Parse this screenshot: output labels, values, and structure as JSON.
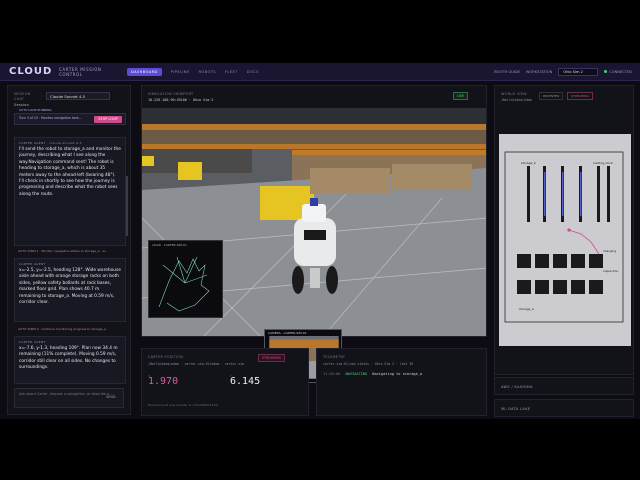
{
  "nav": {
    "logo": "CLOUD",
    "app_title": "CARTER MISSION CONTROL",
    "tabs": [
      "DASHBOARD",
      "PIPELINE",
      "ROBOTS",
      "FLEET",
      "DOCS"
    ],
    "booth_guide": "BOOTH GUIDE",
    "workstation_label": "WORKSTATION",
    "workstation_value": "Ohio Sim 2",
    "status": "CONNECTED"
  },
  "left": {
    "mission_label": "MISSION",
    "chat_label": "CHAT",
    "session_label": "Session",
    "model": "Claude Sonnet 4.5",
    "loop_label": "AUTO LOOP RUNNING",
    "loop_text": "Turn 3 of 10 · Monitor navigation task...",
    "stop_loop": "STOP LOOP",
    "msg1_header": "CARTER AGENT",
    "msg1_model": "claude-sonnet-4-5",
    "msg1_body": "I'll send the robot to storage_a and monitor the journey, describing what I see along the way.Navigation command sent! The robot is heading to storage_a, which is about 35 meters away to the ahead-left (bearing 48°). I'll check in shortly to see how the journey is progressing and describe what the robot sees along the route.",
    "tool1": "AUTO TURN 1 · Monitor navigation status to storage_a - w...",
    "msg2_header": "CARTER AGENT",
    "msg2_body": "x=-2.5, y=-2.5, heading 128°. Wide warehouse aisle ahead with orange storage racks on both sides, yellow safety bollards at rack bases, marked floor grid. Plan shows 40.7 m remaining to storage_a. Moving at 0.59 m/s, corridor clear.",
    "tool2": "AUTO TURN 2 · Continue monitoring progress to storage_a",
    "msg3_header": "CARTER AGENT",
    "msg3_body": "x=-7.6, y-1.3, heading 109°. Plan now 34.4 m remaining (11% complete). Moving 0.59 m/s, corridor still clear on all sides. No changes to surroundings.",
    "input_placeholder": "Ask about Carter, request a navigation, or describe a ...",
    "send_label": "SEND"
  },
  "viewport": {
    "header": "SIMULATION VIEWPORT",
    "sub": "10.226.180.90:49100 · Ohio Sim 2",
    "live": "LIVE",
    "lidar_title": "LIDAR · CARTER-SIM-01",
    "camera_title": "CAMERA · CARTER-SIM-01"
  },
  "carter": {
    "header": "CARTER POSITION",
    "sub": "/World/odom/odom · carter-sim-01/odom · vector.sim",
    "stream": "STREAMING",
    "x_label": "X",
    "y_label": "Y",
    "x": "1.970",
    "y": "6.145",
    "foot": "Received just now (sender ts 1761688103440)"
  },
  "telemetry": {
    "header": "TELEMETRY",
    "sub": "carter-sim-01/nav_status · Ohio Sim 2 · last 30",
    "ts": "11:34:00",
    "level": "NAVIGATING",
    "message": "Navigating to storage_a"
  },
  "world": {
    "header": "WORLD VIEW",
    "sub": "/World/odom/odom",
    "btn": "RECENTER",
    "stream": "STREAMING",
    "labels": [
      "storage_b",
      "loading_dock",
      "charging",
      "inspection",
      "storage_a"
    ]
  },
  "sections": {
    "aws": "AWS / KASHIMA",
    "datalake": "ML DATA LAKE"
  },
  "colors": {
    "accent": "#5b4bd6",
    "pink": "#d14a8b",
    "green": "#55d27a"
  }
}
